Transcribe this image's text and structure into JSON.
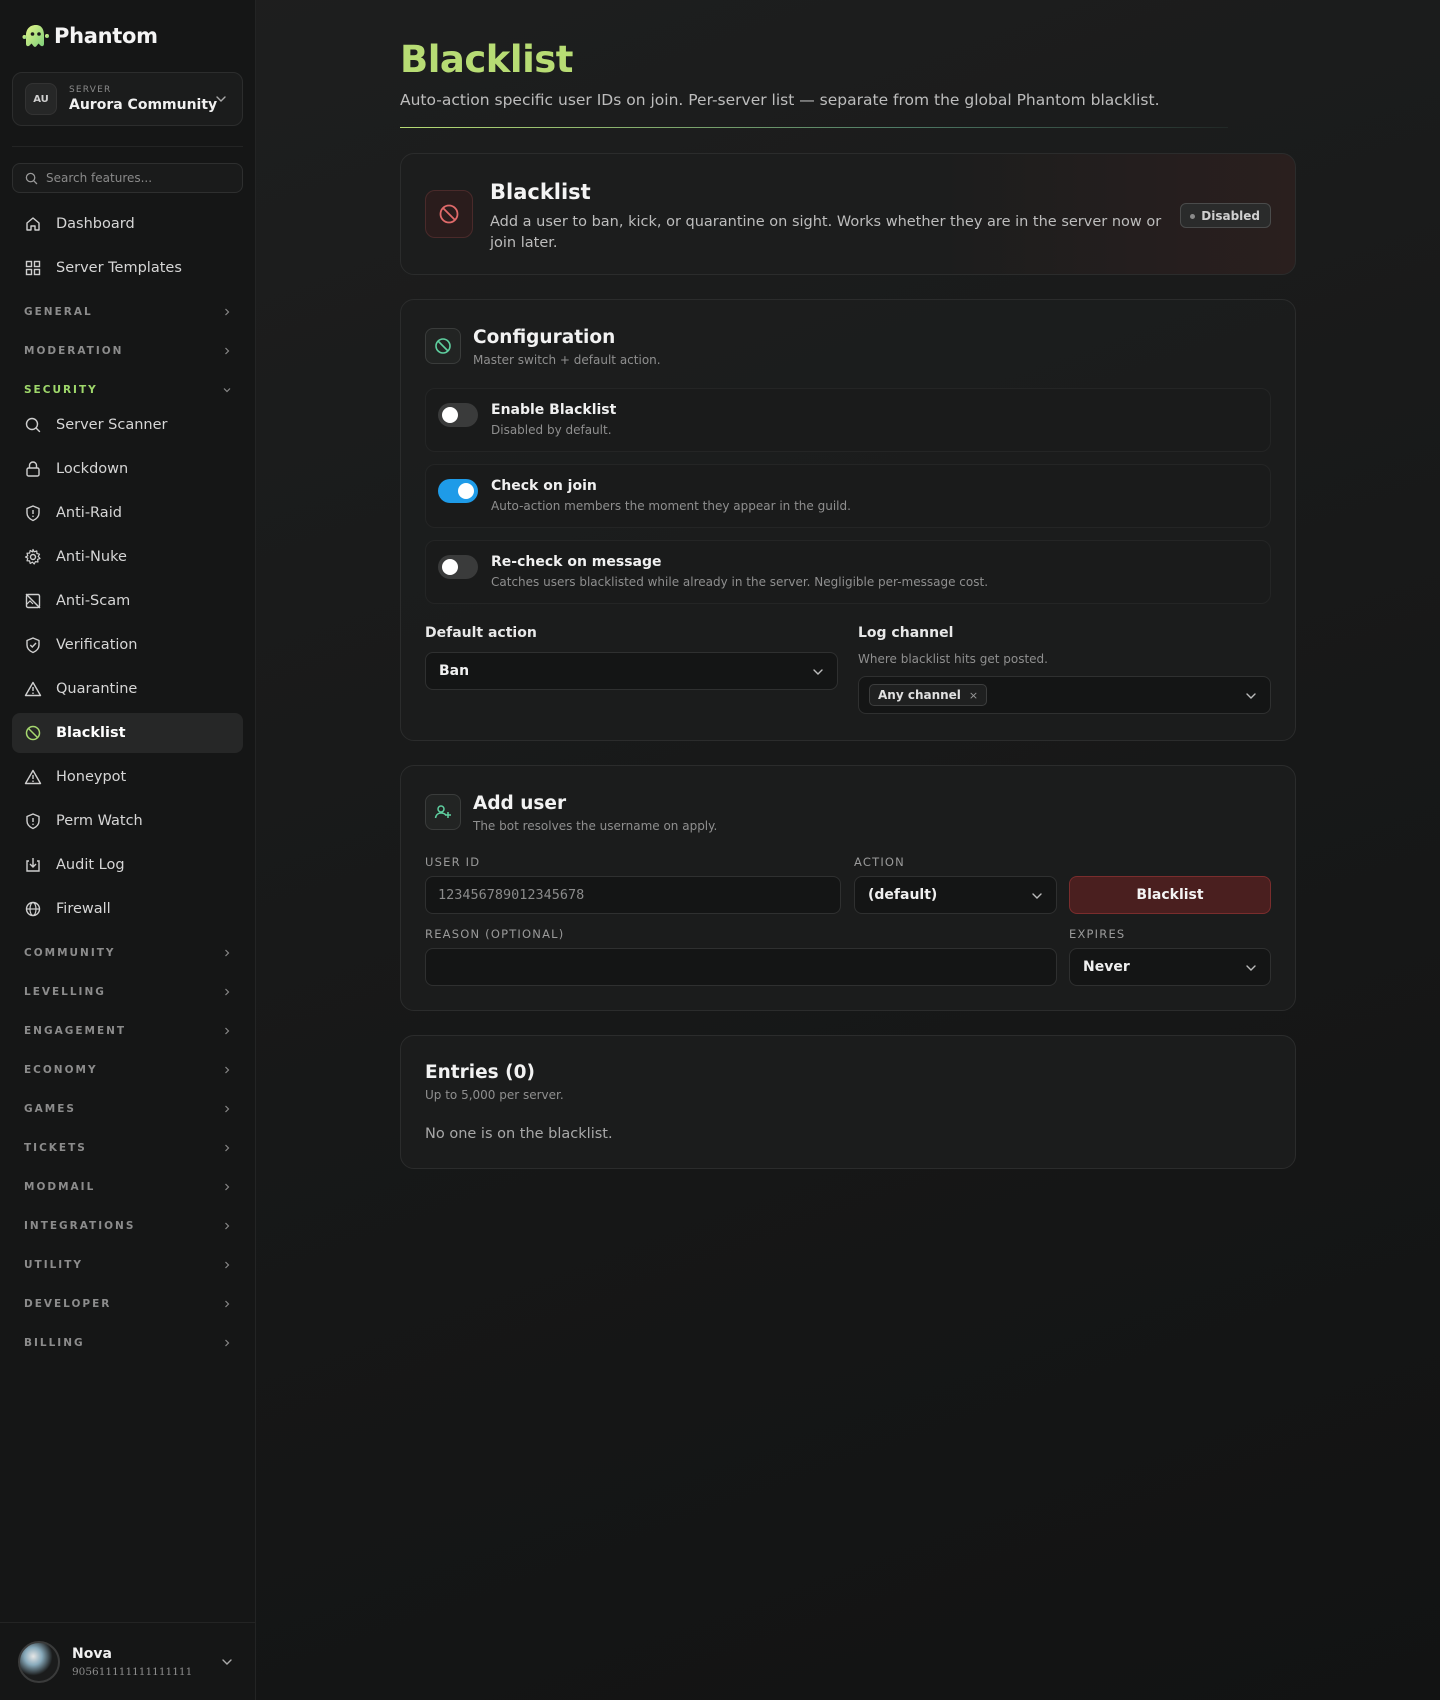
{
  "brand": {
    "name": "Phantom",
    "accent": "#b7dc74"
  },
  "server": {
    "avatar": "AU",
    "label": "SERVER",
    "name": "Aurora Community"
  },
  "search": {
    "placeholder": "Search features..."
  },
  "nav_top": [
    {
      "label": "Dashboard",
      "icon": "home-icon"
    },
    {
      "label": "Server Templates",
      "icon": "grid-icon"
    }
  ],
  "sections_before": [
    "GENERAL",
    "MODERATION"
  ],
  "section_open": "SECURITY",
  "security_items": [
    {
      "label": "Server Scanner",
      "icon": "search-icon"
    },
    {
      "label": "Lockdown",
      "icon": "lock-icon"
    },
    {
      "label": "Anti-Raid",
      "icon": "shield-alert-icon"
    },
    {
      "label": "Anti-Nuke",
      "icon": "gear-icon"
    },
    {
      "label": "Anti-Scam",
      "icon": "crossed-image-icon"
    },
    {
      "label": "Verification",
      "icon": "shield-check-icon"
    },
    {
      "label": "Quarantine",
      "icon": "warning-icon"
    },
    {
      "label": "Blacklist",
      "icon": "ban-icon",
      "active": true
    },
    {
      "label": "Honeypot",
      "icon": "warning-icon"
    },
    {
      "label": "Perm Watch",
      "icon": "shield-alert-icon"
    },
    {
      "label": "Audit Log",
      "icon": "download-box-icon"
    },
    {
      "label": "Firewall",
      "icon": "globe-icon"
    }
  ],
  "sections_after": [
    "COMMUNITY",
    "LEVELLING",
    "ENGAGEMENT",
    "ECONOMY",
    "GAMES",
    "TICKETS",
    "MODMAIL",
    "INTEGRATIONS",
    "UTILITY",
    "DEVELOPER",
    "BILLING"
  ],
  "user": {
    "name": "Nova",
    "id": "905611111111111111"
  },
  "page": {
    "title": "Blacklist",
    "subtitle": "Auto-action specific user IDs on join. Per-server list — separate from the global Phantom blacklist."
  },
  "hero": {
    "title": "Blacklist",
    "description": "Add a user to ban, kick, or quarantine on sight. Works whether they are in the server now or join later.",
    "status": "Disabled"
  },
  "config": {
    "title": "Configuration",
    "description": "Master switch + default action.",
    "toggles": [
      {
        "label": "Enable Blacklist",
        "description": "Disabled by default.",
        "on": false
      },
      {
        "label": "Check on join",
        "description": "Auto-action members the moment they appear in the guild.",
        "on": true
      },
      {
        "label": "Re-check on message",
        "description": "Catches users blacklisted while already in the server. Negligible per-message cost.",
        "on": false
      }
    ],
    "default_action": {
      "label": "Default action",
      "value": "Ban"
    },
    "log_channel": {
      "label": "Log channel",
      "description": "Where blacklist hits get posted.",
      "chip": "Any channel",
      "chip_remove": "×"
    },
    "toggle_on_color": "#1e9be8"
  },
  "add_user": {
    "title": "Add user",
    "description": "The bot resolves the username on apply.",
    "user_id_label": "USER ID",
    "user_id_placeholder": "123456789012345678",
    "action_label": "ACTION",
    "action_value": "(default)",
    "button": "Blacklist",
    "reason_label": "REASON (OPTIONAL)",
    "reason_value": "",
    "expires_label": "EXPIRES",
    "expires_value": "Never"
  },
  "entries": {
    "title": "Entries (0)",
    "description": "Up to 5,000 per server.",
    "empty": "No one is on the blacklist."
  }
}
